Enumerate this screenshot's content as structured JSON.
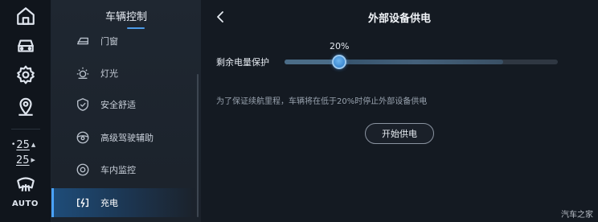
{
  "rail": {
    "icons": [
      "home-icon",
      "car-icon",
      "settings-icon",
      "map-pin-icon",
      "defrost-icon"
    ],
    "temp_upper": "25",
    "temp_lower": "25",
    "mode_label": "AUTO"
  },
  "menu": {
    "title": "车辆控制",
    "items": [
      {
        "label": "门窗",
        "icon": "door-icon",
        "active": false
      },
      {
        "label": "灯光",
        "icon": "light-icon",
        "active": false
      },
      {
        "label": "安全舒适",
        "icon": "shield-icon",
        "active": false
      },
      {
        "label": "高级驾驶辅助",
        "icon": "steering-wheel-icon",
        "active": false
      },
      {
        "label": "车内监控",
        "icon": "camera-icon",
        "active": false
      },
      {
        "label": "充电",
        "icon": "charging-icon",
        "active": true
      }
    ]
  },
  "main": {
    "title": "外部设备供电",
    "slider": {
      "label": "剩余电量保护",
      "value_text": "20%",
      "value": 0.2,
      "range_end": 0.8
    },
    "note": "为了保证续航里程，车辆将在低于20%时停止外部设备供电",
    "button_label": "开始供电"
  },
  "watermark": "汽车之家",
  "colors": {
    "accent": "#4aa3ff",
    "background": "#141a22",
    "menu_background": "#1d242d",
    "active_item": "#1e4d7a"
  }
}
